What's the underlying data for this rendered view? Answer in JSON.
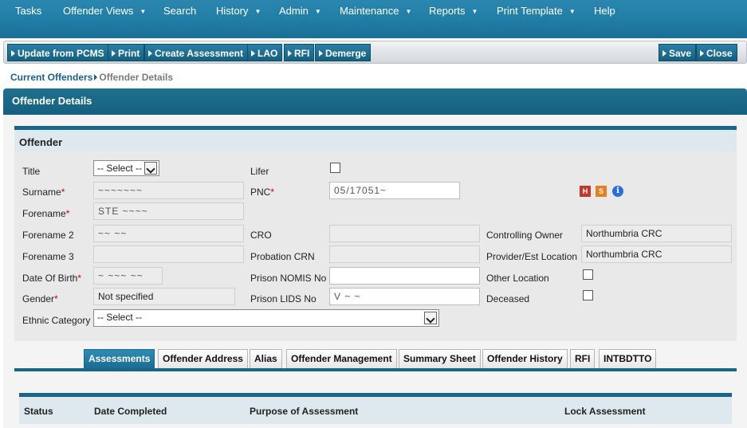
{
  "menu": [
    {
      "label": "Tasks",
      "dropdown": false
    },
    {
      "label": "Offender Views",
      "dropdown": true
    },
    {
      "label": "Search",
      "dropdown": false
    },
    {
      "label": "History",
      "dropdown": true
    },
    {
      "label": "Admin",
      "dropdown": true
    },
    {
      "label": "Maintenance",
      "dropdown": true
    },
    {
      "label": "Reports",
      "dropdown": true
    },
    {
      "label": "Print Template",
      "dropdown": true
    },
    {
      "label": "Help",
      "dropdown": false
    }
  ],
  "toolbar": {
    "update_pcms": "Update from PCMS",
    "print": "Print",
    "create_assessment": "Create Assessment",
    "lao": "LAO",
    "rfi": "RFI",
    "demerge": "Demerge",
    "save": "Save",
    "close": "Close"
  },
  "breadcrumb": {
    "link": "Current Offenders",
    "current": "Offender Details"
  },
  "section_title": "Offender Details",
  "offender": {
    "heading": "Offender",
    "title_label": "Title",
    "title_value": "-- Select --",
    "surname_label": "Surname",
    "surname_value": "~~~~~~~",
    "forename_label": "Forename",
    "forename_value": "STE ~~~~",
    "forename2_label": "Forename 2",
    "forename2_value": "~~ ~~",
    "forename3_label": "Forename 3",
    "forename3_value": "",
    "dob_label": "Date Of Birth",
    "dob_value": "~ ~~~ ~~",
    "gender_label": "Gender",
    "gender_value": "Not specified",
    "ethnic_label": "Ethnic Category",
    "ethnic_value": "-- Select --",
    "lifer_label": "Lifer",
    "pnc_label": "PNC",
    "pnc_value": "05/17051~",
    "cro_label": "CRO",
    "cro_value": "",
    "probation_crn_label": "Probation CRN",
    "probation_crn_value": "",
    "prison_nomis_label": "Prison NOMIS No",
    "prison_nomis_value": "",
    "prison_lids_label": "Prison LIDS No",
    "prison_lids_value": "V ~ ~",
    "controlling_owner_label": "Controlling Owner",
    "controlling_owner_value": "Northumbria CRC",
    "provider_label": "Provider/Est Location",
    "provider_value": "Northumbria CRC",
    "other_location_label": "Other Location",
    "deceased_label": "Deceased",
    "badge_h": "H",
    "badge_s": "S",
    "info": "i"
  },
  "tabs": [
    {
      "label": "Assessments",
      "active": true
    },
    {
      "label": "Offender Address",
      "active": false
    },
    {
      "label": "Alias",
      "active": false
    },
    {
      "label": "Offender Management",
      "active": false
    },
    {
      "label": "Summary Sheet",
      "active": false
    },
    {
      "label": "Offender History",
      "active": false
    },
    {
      "label": "RFI",
      "active": false
    },
    {
      "label": "INTBDTTO",
      "active": false
    }
  ],
  "assessments_table": {
    "columns": [
      "Status",
      "Date Completed",
      "Purpose of Assessment",
      "Lock Assessment"
    ]
  },
  "colors": {
    "brand": "#1a6688",
    "required": "#cc0000",
    "badge_h": "#c0392b",
    "badge_s": "#e67e22",
    "info": "#2a6fd6"
  }
}
